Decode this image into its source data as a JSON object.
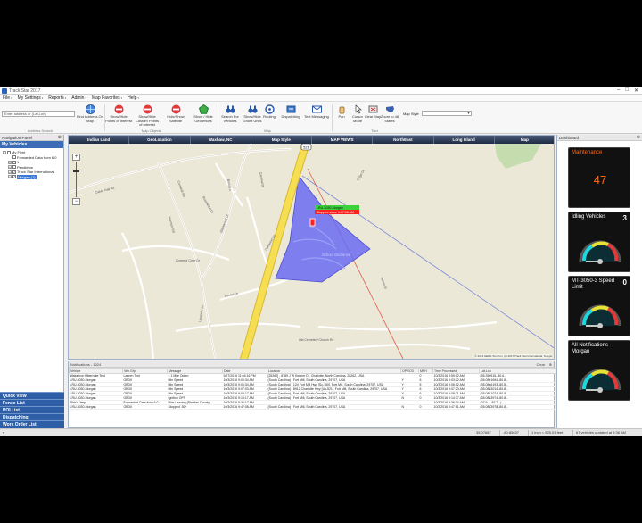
{
  "window": {
    "title": "Track Star 2017"
  },
  "menu": [
    {
      "label": "File"
    },
    {
      "label": "My Settings"
    },
    {
      "label": "Reports"
    },
    {
      "label": "Admin"
    },
    {
      "label": "Map Favorites"
    },
    {
      "label": "Help"
    }
  ],
  "ribbon": {
    "address_placeholder": "Enter address or (Lat,Lon)",
    "address_group": "Address Search",
    "buttons": [
      {
        "label": "Find Address On Map",
        "icon": "globe-icon"
      },
      {
        "label": "Show/Hide Points of Interest",
        "icon": "no-entry-icon"
      },
      {
        "label": "Show/Hide Custom Points of Interest",
        "icon": "no-entry-icon"
      },
      {
        "label": "Hide/Show Satellite",
        "icon": "no-entry-icon"
      },
      {
        "label": "Show / Hide Geofences",
        "icon": "pentagon-icon"
      },
      {
        "label": "Search For Vehicles",
        "icon": "binoculars-icon"
      },
      {
        "label": "Show/Hide Ghost Units",
        "icon": "binoculars-icon"
      },
      {
        "label": "Routing",
        "icon": "steering-wheel-icon"
      },
      {
        "label": "Dispatching",
        "icon": "dispatch-icon"
      },
      {
        "label": "Text Messaging",
        "icon": "envelope-icon"
      },
      {
        "label": "Pan",
        "icon": "hand-icon"
      },
      {
        "label": "Cursor Mode",
        "icon": "cursor-icon"
      },
      {
        "label": "Clear Map",
        "icon": "clear-map-icon"
      },
      {
        "label": "Zoom to 48 States",
        "icon": "usa-icon"
      }
    ],
    "group_labels": [
      "Map Objects",
      "Map",
      "Tool"
    ],
    "map_style_label": "Map Style"
  },
  "left_panel": {
    "title": "Navigation Panel",
    "my_vehicles": "My Vehicles",
    "tree": [
      {
        "label": "My Fleet",
        "level": 0,
        "exp": "−",
        "checked": false
      },
      {
        "label": "Forwarded Data from 6.0",
        "level": 1,
        "exp": "",
        "checked": false
      },
      {
        "label": "1",
        "level": 1,
        "exp": "+",
        "checked": false
      },
      {
        "label": "Pendleton",
        "level": 1,
        "exp": "+",
        "checked": false
      },
      {
        "label": "Track Star International",
        "level": 1,
        "exp": "+",
        "checked": true
      },
      {
        "label": "Morgan (1)",
        "level": 1,
        "exp": "+",
        "checked": true,
        "selected": true
      }
    ],
    "tabs": [
      "Quick View",
      "Fence List",
      "POI List",
      "Dispatching",
      "Work Order List"
    ]
  },
  "map": {
    "header": [
      "Indian Land",
      "GeoLocation",
      "Waxhaw, NC",
      "Map Style",
      "MAP VIEWS",
      "NorthEast",
      "Long Island",
      "Map"
    ],
    "street_labels": [
      "Calvin Hall Rd",
      "Cornwall Rd",
      "Rosewood Dr",
      "Bond Ln",
      "Cardinal Dr",
      "Blackwood Dr",
      "Oakwood Ln",
      "Covered Cove Dr",
      "Sunset Dr",
      "Harrison Rd",
      "Lavendar Ln",
      "Ridge Dr",
      "Old Cemetery Church Rd",
      "Sweet St"
    ],
    "route_shield": "521",
    "geofence_label": "School Geofence",
    "vehicle_label": "LRU-3030-Morgan",
    "vehicle_status": "Stopped since 9:47:08 AM",
    "zoom_in": "+",
    "zoom_out": "−",
    "copyright": "© 2016 HERE TomTom, (c) 2017 Track Star International, Telogis"
  },
  "notifications": {
    "title": "Notifications - 1024",
    "clear": "Clear",
    "columns": [
      "Vehicle",
      "Veh Grp",
      "Message",
      "Date",
      "Location",
      "OP2/O3",
      "MPH",
      "Time Processed",
      "Lat,Lon"
    ],
    "rows": [
      [
        "Waka Iron Hibernate Test",
        "Lauren Test",
        "< 1 Mile Odom",
        "9/27/2016 11:04:16 PM",
        "[25262] - 8789 J W Kenner Dr, Charlotte, North Carolina, 28262, USA",
        "",
        "0",
        "10/3/2016 8:59:12 AM",
        "(35.350515,-80.6..."
      ],
      [
        "LRU-3030-Morgan",
        "OBDII",
        "Min Speed",
        "10/3/2016 9:05:34 AM",
        "(South Carolina) : Fort Mill, South Carolina, 29707, USA",
        "Y",
        "6",
        "10/3/2016 9:03:22 AM",
        "(35.0861694,-80.8..."
      ],
      [
        "LRU-3030-Morgan",
        "OBDII",
        "Min Speed",
        "10/3/2016 9:05:34 AM",
        "(South Carolina) : 124 Fort Mill Hwy [Sc-160], Fort Mill, South Carolina, 29707, USA",
        "Y",
        "5",
        "10/3/2016 9:06:12 AM",
        "(35.0866193,-80.8..."
      ],
      [
        "LRU-3030-Morgan",
        "OBDII",
        "Min Speed",
        "10/3/2016 9:07:03 AM",
        "(South Carolina) : 8912 Charlotte Hwy [Us-521], Fort Mill, South Carolina, 29707, USA",
        "Y",
        "6",
        "10/3/2016 9:07:23 AM",
        "(35.0883014,-80.8..."
      ],
      [
        "LRU-3030-Morgan",
        "OBDII",
        "Min Speed",
        "10/3/2016 9:02:17 AM",
        "(South Carolina) : Fort Mill, South Carolina, 29707, USA",
        "Y",
        "6",
        "10/3/2016 9:08:21 AM",
        "(35.0881074,-80.8..."
      ],
      [
        "LRU-3030-Morgan",
        "OBDII",
        "Ignition OFF",
        "10/3/2016 9:14:17 AM",
        "(South Carolina) : Fort Mill, South Carolina, 29707, USA",
        "N",
        "0",
        "10/3/2016 9:14:37 AM",
        "(35.0883974,-80.8..."
      ],
      [
        "Rick's Jeep",
        "Forwarded Data from 6.0",
        "Rick Leaving (Pinellas County)",
        "10/3/2016 9:35:17 AM",
        "",
        "",
        "",
        "10/3/2016 9:36:04 AM",
        "(27.9...,-82.7...)"
      ],
      [
        "LRU-3030-Morgan",
        "OBDII",
        "Stopped: 30+",
        "10/3/2016 9:47:08 AM",
        "(South Carolina) : Fort Mill, South Carolina, 29707, USA",
        "N",
        "0",
        "10/3/2016 9:47:51 AM",
        "(35.0883978,-80.8..."
      ]
    ]
  },
  "dashboard": {
    "title": "Dashboard",
    "widgets": [
      {
        "title": "Maintenance",
        "value": "47"
      },
      {
        "title": "Idling Vehicles",
        "value": "3"
      },
      {
        "title": "MT-3050-3 Speed Limit",
        "value": "0"
      },
      {
        "title": "All Notifications - Morgan",
        "value": ""
      }
    ]
  },
  "status": {
    "lat": "35.07687",
    "lon": "-80.85637",
    "scale": "1 inch = 525.03 feet",
    "updated": "67 vehicles updated at 9:36 AM"
  },
  "colors": {
    "geofence": "#6b6bf2",
    "road_major": "#f2d43c",
    "nav_blue": "#2e5fa6",
    "maintenance_orange": "#ff6a1a"
  }
}
